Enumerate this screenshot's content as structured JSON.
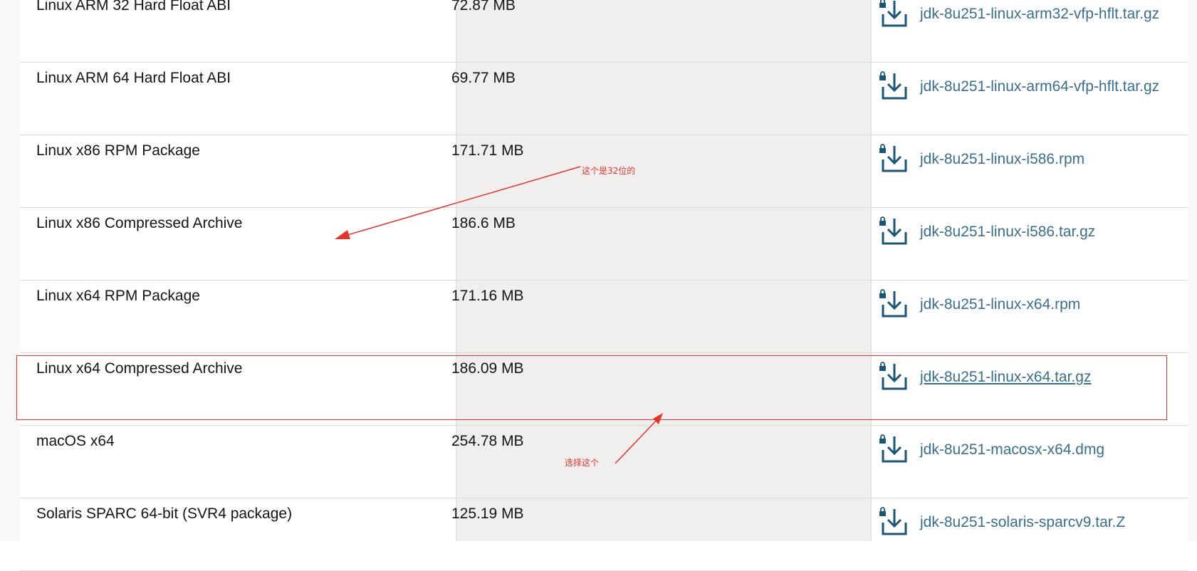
{
  "downloads": [
    {
      "name": "Linux ARM 32 Hard Float ABI",
      "size": "72.87 MB",
      "file": "jdk-8u251-linux-arm32-vfp-hflt.tar.gz"
    },
    {
      "name": "Linux ARM 64 Hard Float ABI",
      "size": "69.77 MB",
      "file": "jdk-8u251-linux-arm64-vfp-hflt.tar.gz"
    },
    {
      "name": "Linux x86 RPM Package",
      "size": "171.71 MB",
      "file": "jdk-8u251-linux-i586.rpm"
    },
    {
      "name": "Linux x86 Compressed Archive",
      "size": "186.6 MB",
      "file": "jdk-8u251-linux-i586.tar.gz"
    },
    {
      "name": "Linux x64 RPM Package",
      "size": "171.16 MB",
      "file": "jdk-8u251-linux-x64.rpm"
    },
    {
      "name": "Linux x64 Compressed Archive",
      "size": "186.09 MB",
      "file": "jdk-8u251-linux-x64.tar.gz"
    },
    {
      "name": "macOS x64",
      "size": "254.78 MB",
      "file": "jdk-8u251-macosx-x64.dmg"
    },
    {
      "name": "Solaris SPARC 64-bit (SVR4 package)",
      "size": "125.19 MB",
      "file": "jdk-8u251-solaris-sparcv9.tar.Z"
    }
  ],
  "annotations": {
    "note_32bit": "这个是32位的",
    "note_select": "选择这个"
  },
  "icons": {
    "download": "download-lock-icon"
  },
  "colors": {
    "link": "#3a6e8a",
    "annotation": "#e0342f",
    "middle_column_bg": "#f1efed"
  }
}
